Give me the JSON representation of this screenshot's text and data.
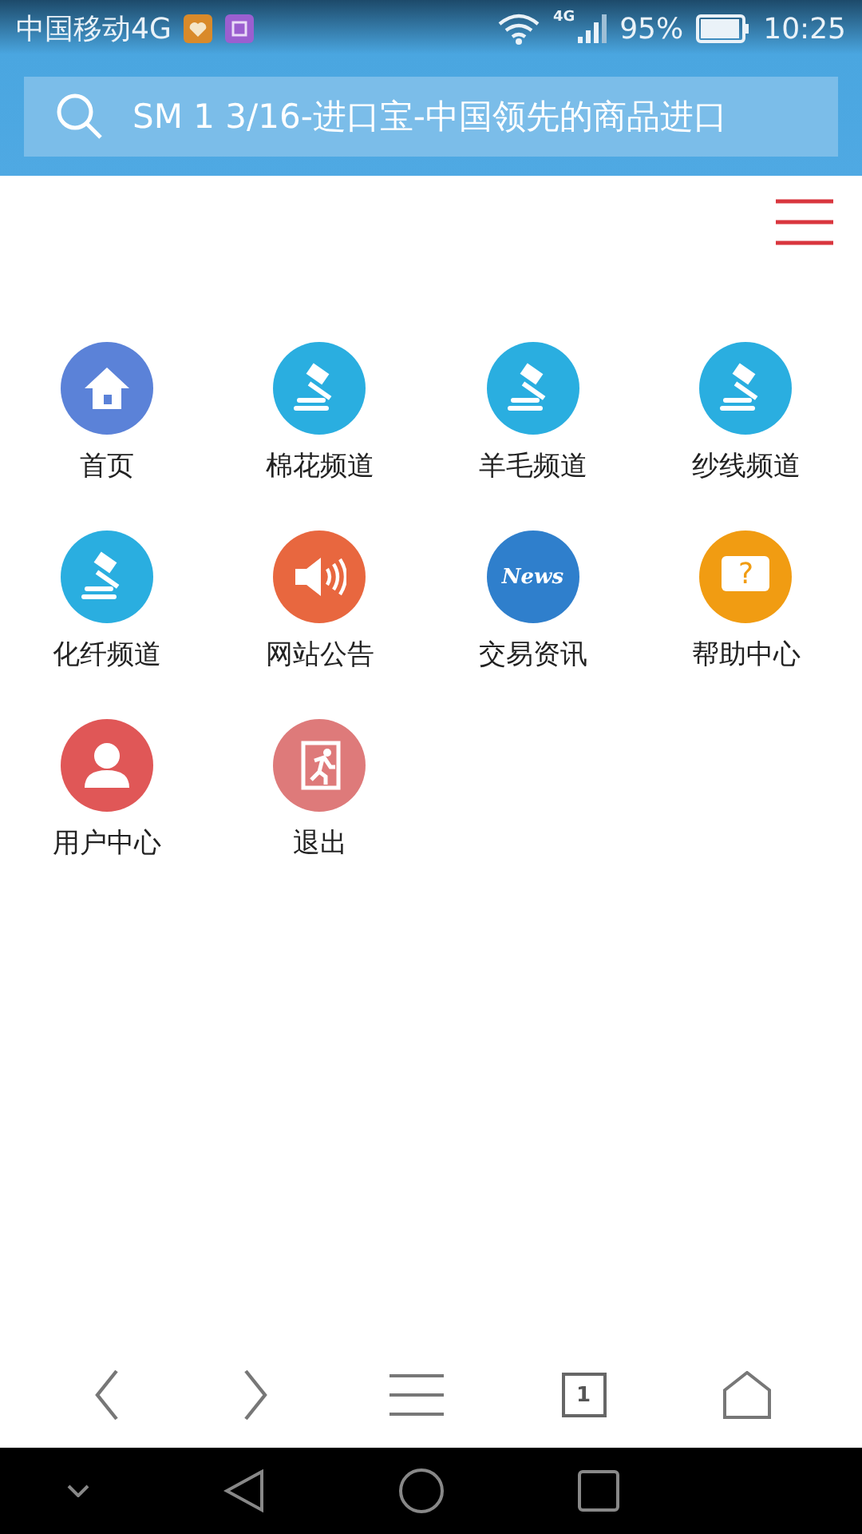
{
  "status_bar": {
    "carrier": "中国移动4G",
    "network": "4G",
    "battery": "95%",
    "time": "10:25"
  },
  "search": {
    "value": "SM 1 3/16-进口宝-中国领先的商品进口"
  },
  "menu": [
    {
      "label": "首页",
      "kind": "home",
      "color": "#5b82d8"
    },
    {
      "label": "棉花频道",
      "kind": "gavel",
      "color": "#2aaee0"
    },
    {
      "label": "羊毛频道",
      "kind": "gavel",
      "color": "#2aaee0"
    },
    {
      "label": "纱线频道",
      "kind": "gavel",
      "color": "#2aaee0"
    },
    {
      "label": "化纤频道",
      "kind": "gavel",
      "color": "#2aaee0"
    },
    {
      "label": "网站公告",
      "kind": "speaker",
      "color": "#e8673f"
    },
    {
      "label": "交易资讯",
      "kind": "news",
      "color": "#2f7fcc",
      "icon_text": "News"
    },
    {
      "label": "帮助中心",
      "kind": "help",
      "color": "#f19c12",
      "icon_text": "?"
    },
    {
      "label": "用户中心",
      "kind": "user",
      "color": "#e05757"
    },
    {
      "label": "退出",
      "kind": "exit",
      "color": "#de7a7a"
    }
  ],
  "toolbar": {
    "tab_count": "1"
  }
}
